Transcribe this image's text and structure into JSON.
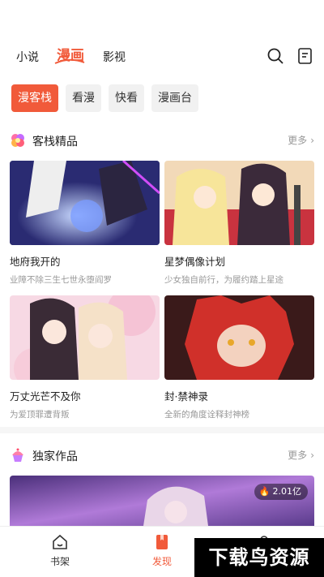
{
  "topnav": {
    "tabs": [
      {
        "label": "小说"
      },
      {
        "label": "漫画"
      },
      {
        "label": "影视"
      }
    ]
  },
  "subtabs": [
    {
      "label": "漫客栈"
    },
    {
      "label": "看漫"
    },
    {
      "label": "快看"
    },
    {
      "label": "漫画台"
    }
  ],
  "section1": {
    "title": "客栈精品",
    "more": "更多",
    "cards": [
      {
        "title": "地府我开的",
        "desc": "业障不除三生七世永堕阎罗"
      },
      {
        "title": "星梦偶像计划",
        "desc": "少女独自前行，为履约踏上星途"
      },
      {
        "title": "万丈光芒不及你",
        "desc": "为爱顶罪遭背叛"
      },
      {
        "title": "封·禁神录",
        "desc": "全新的角度诠释封神榜"
      }
    ]
  },
  "section2": {
    "title": "独家作品",
    "more": "更多",
    "banner_badge": "2.01亿"
  },
  "bottomnav": [
    {
      "label": "书架"
    },
    {
      "label": "发现"
    },
    {
      "label": ""
    }
  ],
  "watermark": "下载鸟资源",
  "colors": {
    "accent": "#f15a3a"
  }
}
